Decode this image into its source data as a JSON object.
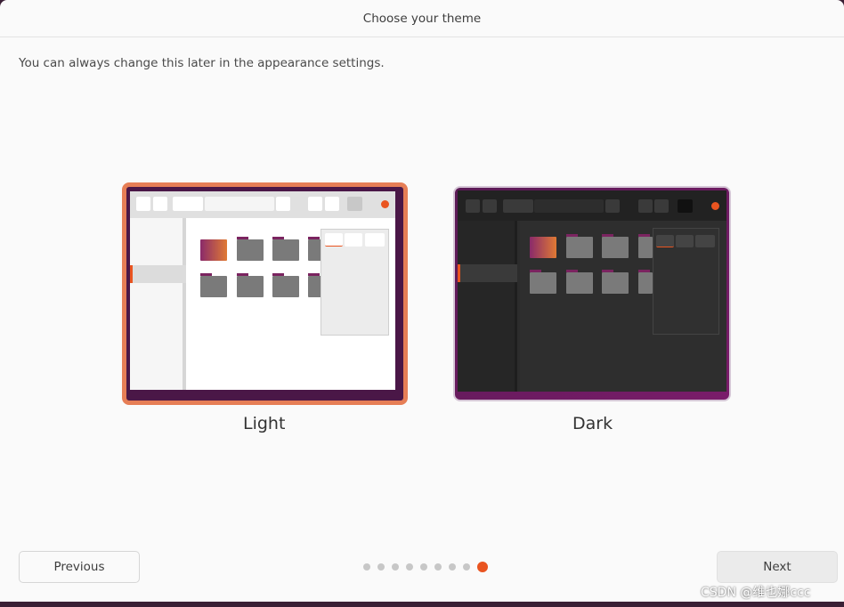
{
  "window": {
    "title": "Choose your theme"
  },
  "subtitle": "You can always change this later in the appearance settings.",
  "themes": [
    {
      "label": "Light",
      "selected": true
    },
    {
      "label": "Dark",
      "selected": false
    }
  ],
  "nav": {
    "previous_label": "Previous",
    "next_label": "Next"
  },
  "pagination": {
    "total": 9,
    "current": 9
  },
  "watermark": "CSDN @维也娜ccc",
  "colors": {
    "accent": "#e95420",
    "selection_border": "#e67e56",
    "window_bg": "#fafafa"
  }
}
